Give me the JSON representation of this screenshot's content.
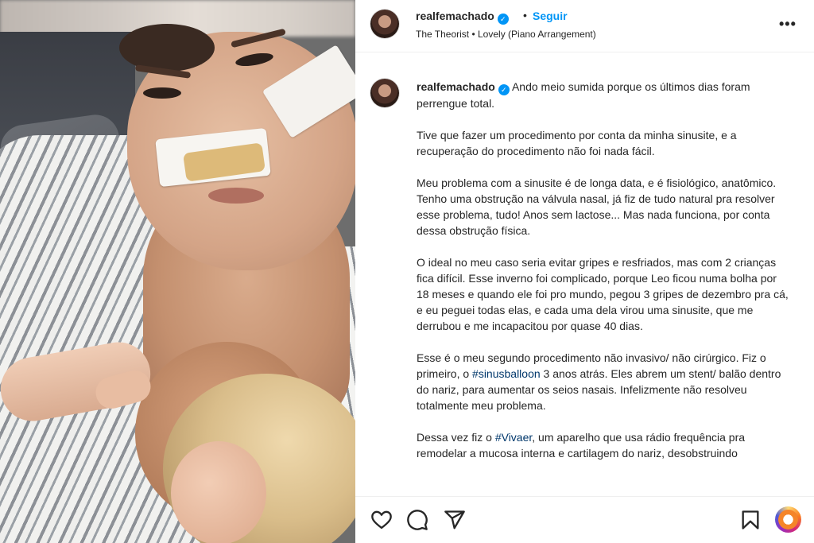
{
  "header": {
    "username": "realfemachado",
    "separator": "•",
    "follow_label": "Seguir",
    "audio": "The Theorist • Lovely (Piano Arrangement)",
    "more_label": "•••"
  },
  "caption": {
    "username": "realfemachado",
    "p1": "Ando meio sumida porque os últimos dias foram perrengue total.",
    "p2": "Tive que fazer um procedimento por conta da minha sinusite, e a recuperação do procedimento não foi nada fácil.",
    "p3": "Meu problema com a sinusite é de longa data, e é fisiológico, anatômico. Tenho uma obstrução na válvula nasal, já fiz de tudo natural pra resolver esse problema, tudo! Anos sem lactose... Mas nada funciona, por conta dessa obstrução física.",
    "p4": "O ideal no meu caso seria evitar gripes e resfriados, mas com 2 crianças fica difícil. Esse inverno foi complicado, porque Leo ficou numa bolha por 18 meses e quando ele foi pro mundo, pegou 3 gripes de dezembro pra cá, e eu peguei todas elas, e cada uma dela virou uma sinusite, que me derrubou e me incapacitou por quase 40 dias.",
    "p5_a": "Esse é o meu segundo procedimento não invasivo/ não cirúrgico. Fiz o primeiro, o ",
    "p5_tag": "#sinusballoon",
    "p5_b": " 3 anos atrás. Eles abrem um stent/ balão dentro do nariz, para aumentar os seios nasais. Infelizmente não resolveu totalmente meu problema.",
    "p6_a": "Dessa vez fiz o ",
    "p6_tag": "#Vivaer",
    "p6_b": ", um aparelho que usa rádio frequência pra remodelar a mucosa interna e cartilagem do nariz, desobstruindo"
  },
  "actions": {
    "icons": [
      "heart-icon",
      "comment-icon",
      "share-icon",
      "bookmark-icon",
      "reels-icon"
    ]
  },
  "colors": {
    "accent": "#0095f6",
    "hashtag": "#00376b",
    "text": "#262626",
    "border": "#efefef"
  }
}
